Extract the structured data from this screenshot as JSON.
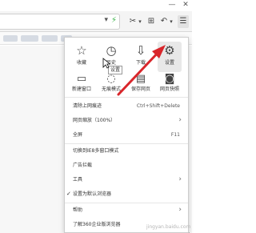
{
  "menu": {
    "grid": [
      {
        "label": "收藏",
        "icon": "star-icon",
        "glyph": "☆"
      },
      {
        "label": "历史",
        "icon": "clock-icon",
        "glyph": "◷"
      },
      {
        "label": "下载",
        "icon": "download-icon",
        "glyph": "⇩"
      },
      {
        "label": "设置",
        "icon": "gear-icon",
        "glyph": "⚙"
      },
      {
        "label": "新建窗口",
        "icon": "new-window-icon",
        "glyph": "▭"
      },
      {
        "label": "无痕模式",
        "icon": "incognito-icon",
        "glyph": "◌"
      },
      {
        "label": "保存网页",
        "icon": "save-page-icon",
        "glyph": "▤"
      },
      {
        "label": "网页快照",
        "icon": "camera-icon",
        "glyph": "◙"
      }
    ],
    "items": [
      {
        "label": "清除上网痕迹",
        "shortcut": "Ctrl+Shift+Delete"
      },
      {
        "label": "网页缩放（100%）",
        "arrow": "›"
      },
      {
        "label": "全屏",
        "shortcut": "F11"
      },
      {
        "label": "切换到IE8多窗口模式"
      },
      {
        "label": "广告拦截"
      },
      {
        "label": "工具",
        "arrow": "›"
      },
      {
        "label": "设置为默认浏览器",
        "check": "✓"
      },
      {
        "label": "帮助",
        "arrow": "›"
      },
      {
        "label": "了解360企业版浏览器"
      }
    ]
  },
  "tooltip": "设置",
  "toolbar": {
    "scissors": "✂",
    "grid": "⊞",
    "undo": "↶",
    "menu": "☰",
    "dropdown": "▾",
    "flash": "⚡",
    "chevron": "▾"
  },
  "window": {
    "minimize": "—",
    "close": "✕"
  },
  "watermark": "jingyan.baidu.com",
  "colors": {
    "arrow": "#d9262b",
    "highlight": "#e8e8e8"
  }
}
